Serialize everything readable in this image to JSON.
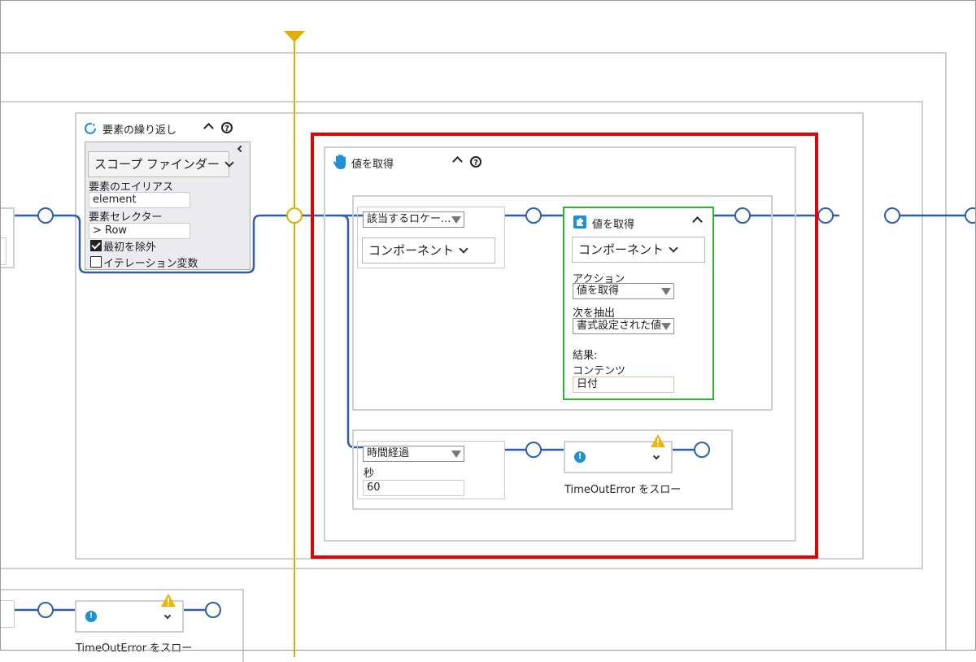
{
  "loop_block": {
    "title": "要素の繰り返し",
    "dropdown_label": "スコープ ファインダー",
    "alias_label": "要素のエイリアス",
    "alias_value": "element",
    "selector_label": "要素セレクター",
    "selector_value": "> Row",
    "exclude_first_label": "最初を除外",
    "exclude_first_checked": true,
    "iteration_var_label": "イテレーション変数",
    "iteration_var_checked": false
  },
  "get_value_block": {
    "title": "値を取得",
    "locator_select": "該当するロケー...",
    "component_button": "コンポーネント",
    "timeout_select": "時間経過",
    "seconds_label": "秒",
    "seconds_value": "60",
    "throw_label": "TimeOutError をスロー"
  },
  "get_value_component": {
    "title": "値を取得",
    "component_button": "コンポーネント",
    "action_label": "アクション",
    "action_value": "値を取得",
    "extract_label": "次を抽出",
    "extract_value": "書式設定された値",
    "result_label": "結果:",
    "content_label": "コンテンツ",
    "content_value": "日付"
  },
  "bottom_block": {
    "throw_label": "TimeOutError をスロー"
  },
  "colors": {
    "wire": "#2e5fa8",
    "timeline": "#e0b000",
    "highlight_red": "#e60000",
    "highlight_green": "#2db52d",
    "warning": "#f0b400",
    "info": "#1e90d8"
  }
}
